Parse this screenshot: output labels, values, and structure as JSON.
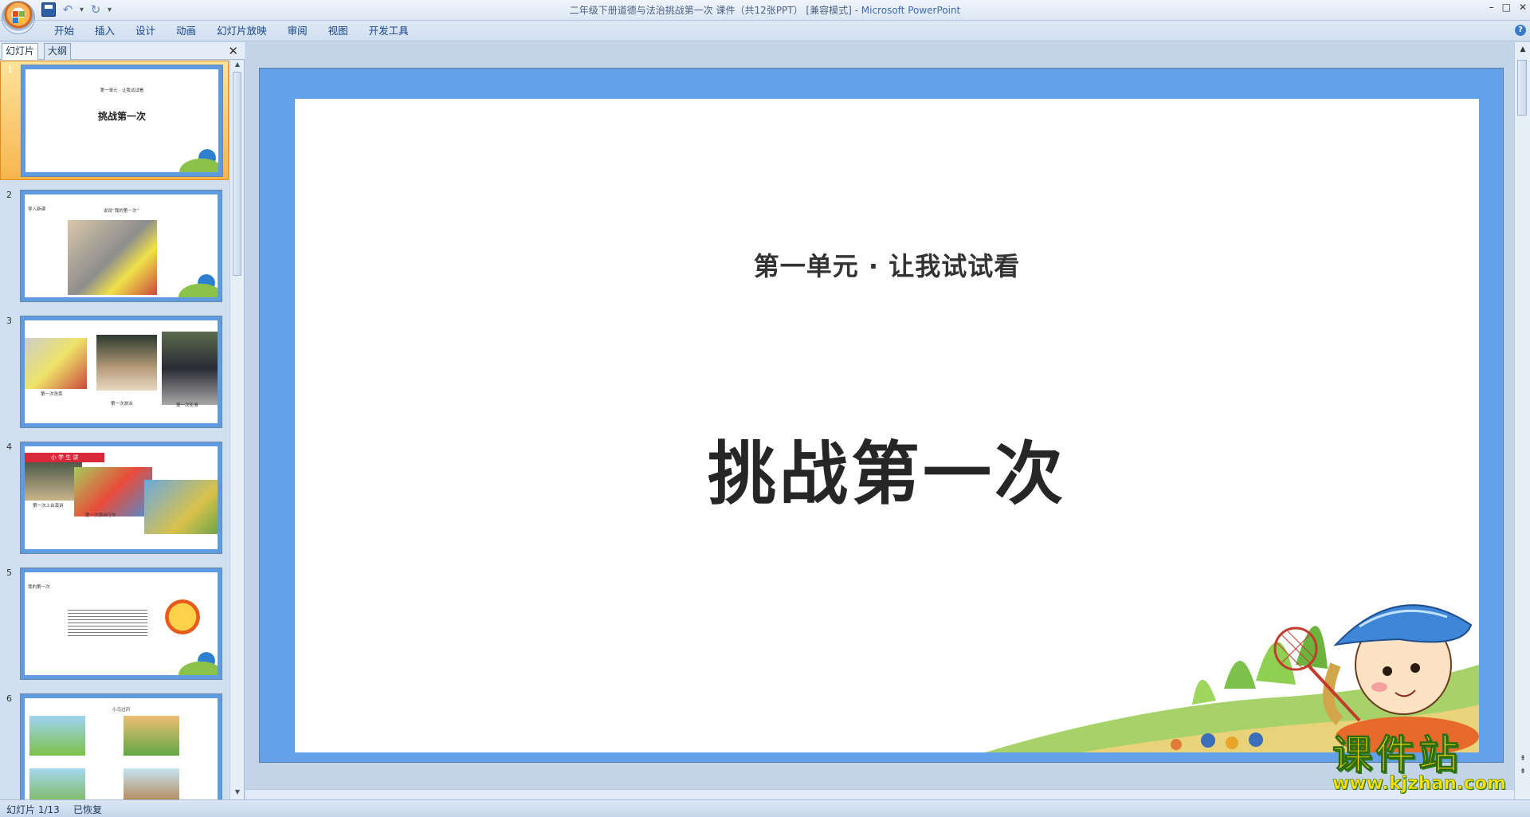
{
  "window": {
    "title": "二年级下册道德与法治挑战第一次 课件（共12张PPT） [兼容模式] - ",
    "app_name": "Microsoft PowerPoint",
    "controls": [
      "–",
      "□",
      "✕"
    ]
  },
  "quick_access": {
    "save_icon": "save-icon",
    "undo_icon": "undo-icon",
    "redo_icon": "redo-icon"
  },
  "ribbon": {
    "tabs": [
      "开始",
      "插入",
      "设计",
      "动画",
      "幻灯片放映",
      "审阅",
      "视图",
      "开发工具"
    ]
  },
  "panel": {
    "tab_slides": "幻灯片",
    "tab_outline": "大纲",
    "close": "✕"
  },
  "slides": [
    {
      "number": "1",
      "subtitle": "第一单元 · 让我试试看",
      "title": "挑战第一次"
    },
    {
      "number": "2",
      "corner": "导入新课",
      "heading": "说说“我的第一次”"
    },
    {
      "number": "3",
      "cap1": "第一次洗菜",
      "cap2": "第一次游泳",
      "cap3": "第一次轮滑"
    },
    {
      "number": "4",
      "banner": "小 学 生 讲",
      "cap1": "第一次上台演讲",
      "cap2": "第一次骑自行车"
    },
    {
      "number": "5",
      "corner": "我的第一次"
    },
    {
      "number": "6",
      "heading": "小马过河"
    }
  ],
  "main_slide": {
    "subtitle": "第一单元 · 让我试试看",
    "title": "挑战第一次"
  },
  "status": {
    "slide_indicator": "幻灯片 1/13",
    "restored": "已恢复"
  },
  "watermark": {
    "cn": "课件站",
    "url": "www.kjzhan.com"
  },
  "colors": {
    "slide_border": "#63a2ea",
    "selected_thumb": "#f7b64c",
    "ribbon_text": "#15428b"
  }
}
